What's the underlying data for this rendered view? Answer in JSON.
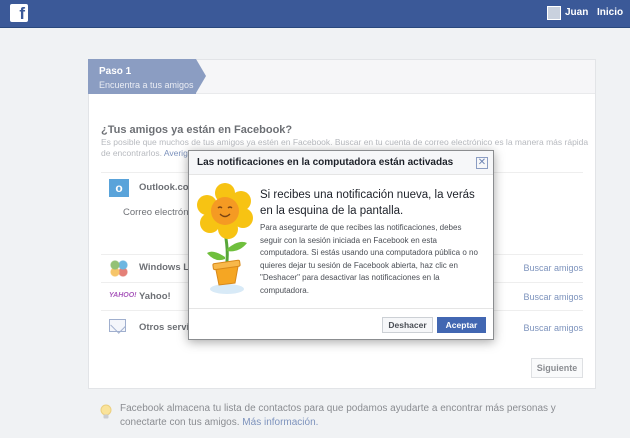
{
  "topbar": {
    "logo": "f",
    "profile_name": "Juan",
    "home_link": "Inicio",
    "color": "#3b5998"
  },
  "step": {
    "title": "Paso 1",
    "subtitle": "Encuentra a tus amigos"
  },
  "section": {
    "title": "¿Tus amigos ya están en Facebook?",
    "description": "Es posible que muchos de tus amigos ya estén en Facebook. Buscar en tu cuenta de correo electrónico es la manera más rápida de encontrarlos.",
    "link": "Averigua cómo funciona."
  },
  "providers": [
    {
      "name": "Outlook.com",
      "sublabel": "Correo electrónico",
      "icon": "outlook-icon"
    },
    {
      "name": "Windows Live",
      "button": "Buscar amigos",
      "icon": "windows-live-icon"
    },
    {
      "name": "Yahoo!",
      "button": "Buscar amigos",
      "icon": "yahoo-icon"
    },
    {
      "name": "Otros servicios",
      "button": "Buscar amigos",
      "icon": "mail-icon"
    }
  ],
  "next_button": "Siguiente",
  "tip": {
    "text": "Facebook almacena tu lista de contactos para que podamos ayudarte a encontrar más personas y conectarte con tus amigos.",
    "link": "Más información."
  },
  "dialog": {
    "title": "Las notificaciones en la computadora están activadas",
    "lead": "Si recibes una notificación nueva, la verás en la esquina de la pantalla.",
    "body": "Para asegurarte de que recibes las notificaciones, debes seguir con la sesión iniciada en Facebook en esta computadora. Si estás usando una computadora pública o no quieres dejar tu sesión de Facebook abierta, haz clic en \"Deshacer\" para desactivar las notificaciones en la computadora.",
    "undo_button": "Deshacer",
    "accept_button": "Aceptar",
    "close_symbol": "✕",
    "accent_color": "#4267b2"
  }
}
